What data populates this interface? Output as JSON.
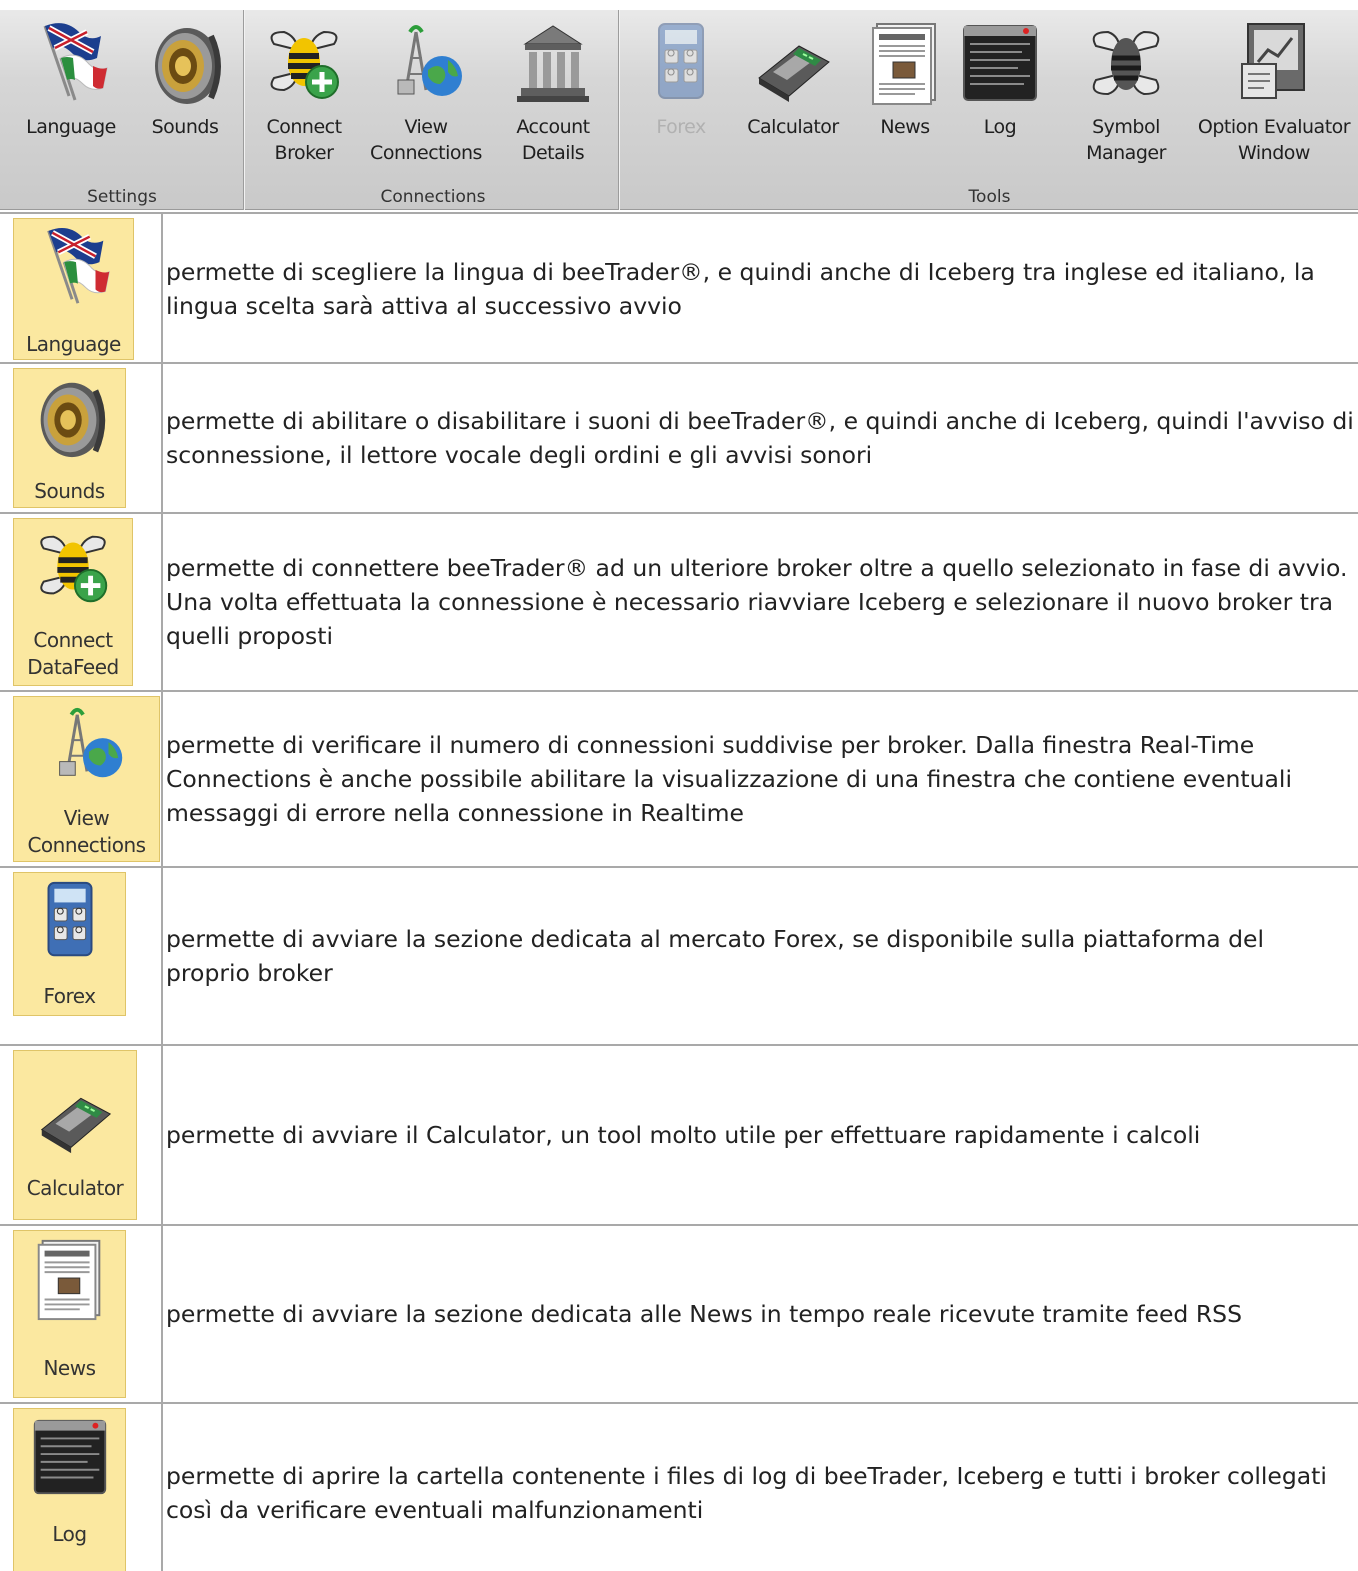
{
  "ribbon": {
    "groups": [
      {
        "label": "Settings"
      },
      {
        "label": "Connections"
      },
      {
        "label": "Tools"
      }
    ],
    "buttons": [
      {
        "label": "Language",
        "icon": "flags-icon",
        "disabled": false
      },
      {
        "label": "Sounds",
        "icon": "speaker-icon",
        "disabled": false
      },
      {
        "label": "Connect\nBroker",
        "icon": "bee-plus-icon",
        "disabled": false
      },
      {
        "label": "View\nConnections",
        "icon": "antenna-globe-icon",
        "disabled": false
      },
      {
        "label": "Account\nDetails",
        "icon": "bank-icon",
        "disabled": false
      },
      {
        "label": "Forex",
        "icon": "forex-calculator-icon",
        "disabled": true
      },
      {
        "label": "Calculator",
        "icon": "calculator-icon",
        "disabled": false
      },
      {
        "label": "News",
        "icon": "newspaper-icon",
        "disabled": false
      },
      {
        "label": "Log",
        "icon": "log-window-icon",
        "disabled": false
      },
      {
        "label": "Symbol\nManager",
        "icon": "bee-icon",
        "disabled": false
      },
      {
        "label": "Option Evaluator\nWindow",
        "icon": "option-evaluator-icon",
        "disabled": false
      }
    ]
  },
  "rows": [
    {
      "tile_label": "Language",
      "icon": "flags-icon",
      "text": "permette di scegliere la lingua di beeTrader®, e quindi anche di Iceberg tra inglese ed italiano, la lingua scelta sarà attiva al successivo avvio"
    },
    {
      "tile_label": "Sounds",
      "icon": "speaker-icon",
      "text": "permette di abilitare o disabilitare i suoni di beeTrader®, e quindi anche di Iceberg, quindi l'avviso di sconnessione, il lettore vocale degli ordini e gli avvisi sonori"
    },
    {
      "tile_label": "Connect\nDataFeed",
      "icon": "bee-plus-icon",
      "text": "permette di connettere beeTrader® ad un ulteriore broker oltre a quello selezionato in fase di avvio. Una volta effettuata la connessione è necessario riavviare Iceberg e selezionare il nuovo broker tra quelli proposti"
    },
    {
      "tile_label": "View\nConnections",
      "icon": "antenna-globe-icon",
      "text": "permette di verificare il numero di connessioni suddivise per broker. Dalla finestra Real-Time Connections è anche possibile abilitare la visualizzazione di una finestra che contiene eventuali messaggi di errore nella connessione in Realtime"
    },
    {
      "tile_label": "Forex",
      "icon": "forex-calculator-icon",
      "text": "permette di avviare la sezione dedicata al mercato Forex, se disponibile sulla piattaforma del proprio broker"
    },
    {
      "tile_label": "Calculator",
      "icon": "calculator-icon",
      "text": "permette di avviare il Calculator, un tool molto utile per effettuare rapidamente i calcoli"
    },
    {
      "tile_label": "News",
      "icon": "newspaper-icon",
      "text": "permette di avviare la sezione dedicata alle News in tempo reale ricevute tramite feed RSS"
    },
    {
      "tile_label": "Log",
      "icon": "log-window-icon",
      "text": "permette di aprire la cartella contenente i files di log di beeTrader, Iceberg e tutti i broker collegati così da verificare eventuali malfunzionamenti"
    }
  ]
}
